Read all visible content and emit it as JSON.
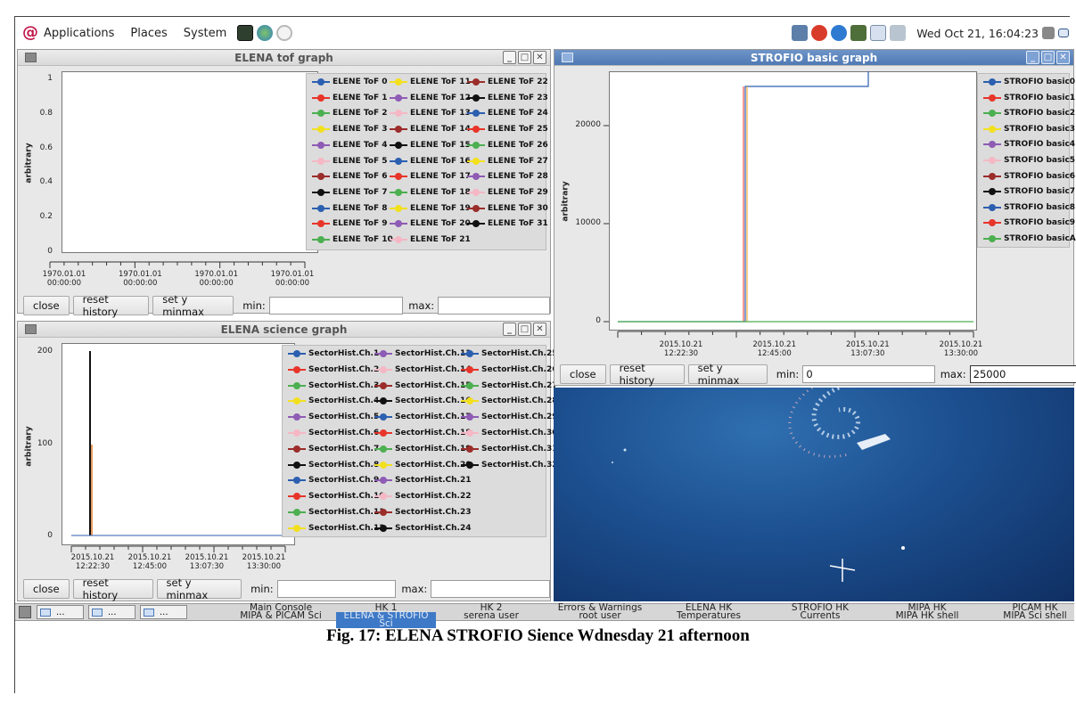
{
  "top_panel": {
    "menus": [
      "Applications",
      "Places",
      "System"
    ],
    "clock": "Wed Oct 21, 16:04:23"
  },
  "tof_window": {
    "title": "ELENA tof graph",
    "ylabel": "arbitrary",
    "yticks": [
      "1",
      "0.8",
      "0.6",
      "0.4",
      "0.2",
      "0"
    ],
    "xticks": [
      [
        "1970.01.01",
        "00:00:00"
      ],
      [
        "1970.01.01",
        "00:00:00"
      ],
      [
        "1970.01.01",
        "00:00:00"
      ],
      [
        "1970.01.01",
        "00:00:00"
      ]
    ],
    "legend": [
      [
        "ELENE ToF 0",
        "ELENE ToF 1",
        "ELENE ToF 2",
        "ELENE ToF 3",
        "ELENE ToF 4",
        "ELENE ToF 5",
        "ELENE ToF 6",
        "ELENE ToF 7",
        "ELENE ToF 8",
        "ELENE ToF 9",
        "ELENE ToF 10"
      ],
      [
        "ELENE ToF 11",
        "ELENE ToF 12",
        "ELENE ToF 13",
        "ELENE ToF 14",
        "ELENE ToF 15",
        "ELENE ToF 16",
        "ELENE ToF 17",
        "ELENE ToF 18",
        "ELENE ToF 19",
        "ELENE ToF 20",
        "ELENE ToF 21"
      ],
      [
        "ELENE ToF 22",
        "ELENE ToF 23",
        "ELENE ToF 24",
        "ELENE ToF 25",
        "ELENE ToF 26",
        "ELENE ToF 27",
        "ELENE ToF 28",
        "ELENE ToF 29",
        "ELENE ToF 30",
        "ELENE ToF 31"
      ]
    ],
    "buttons": {
      "close": "close",
      "reset": "reset history",
      "minmax": "set y minmax"
    },
    "min_label": "min:",
    "max_label": "max:",
    "min_value": "",
    "max_value": ""
  },
  "science_window": {
    "title": "ELENA science graph",
    "ylabel": "arbitrary",
    "yticks": [
      "200",
      "100",
      "0"
    ],
    "xticks": [
      [
        "2015.10.21",
        "12:22:30"
      ],
      [
        "2015.10.21",
        "12:45:00"
      ],
      [
        "2015.10.21",
        "13:07:30"
      ],
      [
        "2015.10.21",
        "13:30:00"
      ]
    ],
    "legend": [
      [
        "SectorHist.Ch.1",
        "SectorHist.Ch.2",
        "SectorHist.Ch.3",
        "SectorHist.Ch.4",
        "SectorHist.Ch.5",
        "SectorHist.Ch.6",
        "SectorHist.Ch.7",
        "SectorHist.Ch.8",
        "SectorHist.Ch.9",
        "SectorHist.Ch.10",
        "SectorHist.Ch.11",
        "SectorHist.Ch.12"
      ],
      [
        "SectorHist.Ch.13",
        "SectorHist.Ch.14",
        "SectorHist.Ch.15",
        "SectorHist.Ch.16",
        "SectorHist.Ch.17",
        "SectorHist.Ch.18",
        "SectorHist.Ch.19",
        "SectorHist.Ch.20",
        "SectorHist.Ch.21",
        "SectorHist.Ch.22",
        "SectorHist.Ch.23",
        "SectorHist.Ch.24"
      ],
      [
        "SectorHist.Ch.25",
        "SectorHist.Ch.26",
        "SectorHist.Ch.27",
        "SectorHist.Ch.28",
        "SectorHist.Ch.29",
        "SectorHist.Ch.30",
        "SectorHist.Ch.31",
        "SectorHist.Ch.32"
      ]
    ],
    "buttons": {
      "close": "close",
      "reset": "reset history",
      "minmax": "set y minmax"
    },
    "min_label": "min:",
    "max_label": "max:",
    "min_value": "",
    "max_value": ""
  },
  "strofio_window": {
    "title": "STROFIO basic graph",
    "ylabel": "arbitrary",
    "yticks": [
      "20000",
      "10000",
      "0"
    ],
    "xticks": [
      [
        "2015.10.21",
        "12:22:30"
      ],
      [
        "2015.10.21",
        "12:45:00"
      ],
      [
        "2015.10.21",
        "13:07:30"
      ],
      [
        "2015.10.21",
        "13:30:00"
      ]
    ],
    "legend": [
      "STROFIO basic0",
      "STROFIO basic1",
      "STROFIO basic2",
      "STROFIO basic3",
      "STROFIO basic4",
      "STROFIO basic5",
      "STROFIO basic6",
      "STROFIO basic7",
      "STROFIO basic8",
      "STROFIO basic9",
      "STROFIO basicA"
    ],
    "buttons": {
      "close": "close",
      "reset": "reset history",
      "minmax": "set y minmax"
    },
    "min_label": "min:",
    "max_label": "max:",
    "min_value": "0",
    "max_value": "25000"
  },
  "legend_colors": [
    "#2c5fb0",
    "#e8352a",
    "#4caf50",
    "#f2e01f",
    "#8e5bb5",
    "#f5b7c4",
    "#9b2d2a",
    "#111111"
  ],
  "taskbar": {
    "mini_buttons": [
      "...",
      "...",
      "..."
    ],
    "pairs": [
      [
        "Main Console",
        "MIPA & PICAM Sci"
      ],
      [
        "HK 1",
        "ELENA & STROFIO Sci"
      ],
      [
        "HK 2",
        "serena user"
      ],
      [
        "Errors & Warnings",
        "root user"
      ],
      [
        "ELENA HK",
        "Temperatures"
      ],
      [
        "STROFIO HK",
        "Currents"
      ],
      [
        "MIPA HK",
        "MIPA HK shell"
      ],
      [
        "PICAM HK",
        "MIPA Sci shell"
      ]
    ]
  },
  "caption": "Fig. 17: ELENA STROFIO Sience Wdnesday 21 afternoon"
}
